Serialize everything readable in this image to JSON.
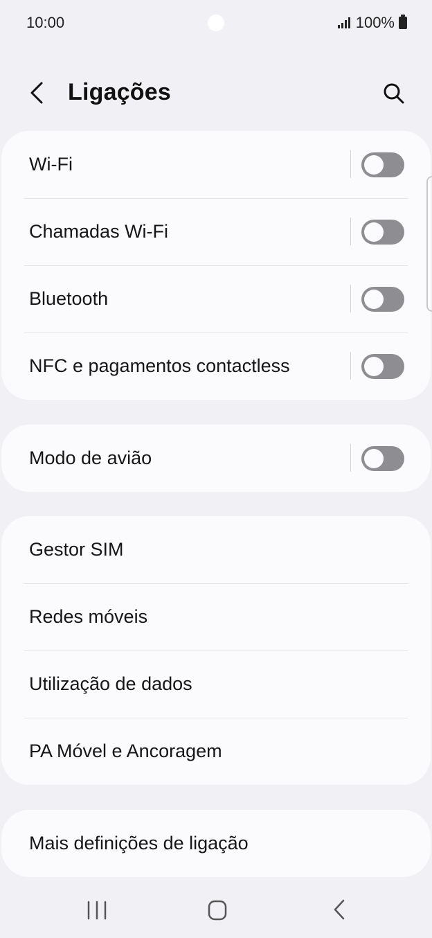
{
  "status_bar": {
    "time": "10:00",
    "battery": "100%",
    "icons": [
      "signal-icon",
      "battery-icon"
    ]
  },
  "header": {
    "title": "Ligações",
    "back_icon": "chevron-left-icon",
    "search_icon": "search-icon"
  },
  "groups": [
    {
      "items": [
        {
          "label": "Wi-Fi",
          "toggle": false
        },
        {
          "label": "Chamadas Wi-Fi",
          "toggle": false
        },
        {
          "label": "Bluetooth",
          "toggle": false
        },
        {
          "label": "NFC e pagamentos contactless",
          "toggle": false
        }
      ]
    },
    {
      "items": [
        {
          "label": "Modo de avião",
          "toggle": false
        }
      ]
    },
    {
      "items": [
        {
          "label": "Gestor SIM"
        },
        {
          "label": "Redes móveis"
        },
        {
          "label": "Utilização de dados"
        },
        {
          "label": "PA Móvel e Ancoragem"
        }
      ]
    },
    {
      "items": [
        {
          "label": "Mais definições de ligação"
        }
      ]
    }
  ],
  "nav_bar": {
    "icons": [
      "recent-apps-icon",
      "home-icon",
      "back-icon"
    ]
  },
  "colors": {
    "background": "#f1f1f5",
    "card": "#fbfbfd",
    "toggle_off": "#8e8e92",
    "divider": "#e3e3e7"
  }
}
